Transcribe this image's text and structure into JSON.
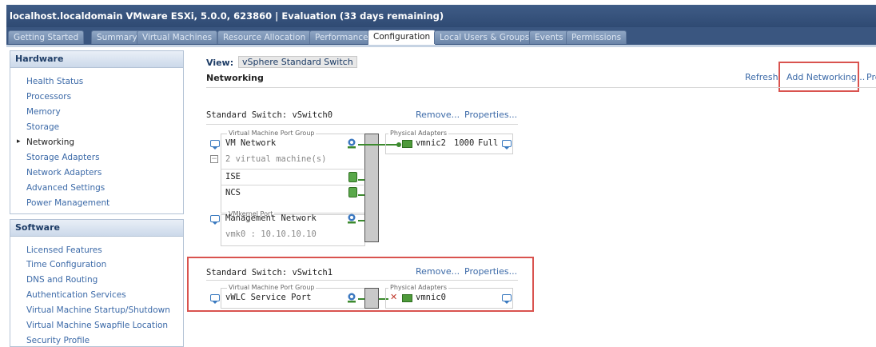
{
  "window": {
    "title": "localhost.localdomain VMware ESXi, 5.0.0, 623860 | Evaluation (33 days remaining)"
  },
  "tabs": [
    {
      "label": "Getting Started"
    },
    {
      "label": "Summary"
    },
    {
      "label": "Virtual Machines"
    },
    {
      "label": "Resource Allocation"
    },
    {
      "label": "Performance"
    },
    {
      "label": "Configuration",
      "active": true
    },
    {
      "label": "Local Users & Groups"
    },
    {
      "label": "Events"
    },
    {
      "label": "Permissions"
    }
  ],
  "sidebar": {
    "hardware_title": "Hardware",
    "hardware_items": [
      {
        "label": "Health Status"
      },
      {
        "label": "Processors"
      },
      {
        "label": "Memory"
      },
      {
        "label": "Storage"
      },
      {
        "label": "Networking",
        "selected": true
      },
      {
        "label": "Storage Adapters"
      },
      {
        "label": "Network Adapters"
      },
      {
        "label": "Advanced Settings"
      },
      {
        "label": "Power Management"
      }
    ],
    "software_title": "Software",
    "software_items": [
      {
        "label": "Licensed Features"
      },
      {
        "label": "Time Configuration"
      },
      {
        "label": "DNS and Routing"
      },
      {
        "label": "Authentication Services"
      },
      {
        "label": "Virtual Machine Startup/Shutdown"
      },
      {
        "label": "Virtual Machine Swapfile Location"
      },
      {
        "label": "Security Profile"
      }
    ]
  },
  "main": {
    "view_label": "View:",
    "view_value": "vSphere Standard Switch",
    "heading": "Networking",
    "actions": {
      "refresh": "Refresh",
      "add_networking": "Add Networking...",
      "properties_partial": "Pro"
    },
    "switch0": {
      "title": "Standard Switch: vSwitch0",
      "remove": "Remove...",
      "properties": "Properties...",
      "vm_port_group_label": "Virtual Machine Port Group",
      "vm_network": "VM Network",
      "vm_count": "2 virtual machine(s)",
      "vms": [
        "ISE",
        "NCS"
      ],
      "vmkernel_label": "VMkernel Port",
      "mgmt_network": "Management Network",
      "vmk": "vmk0 : 10.10.10.10",
      "physical_adapters_label": "Physical Adapters",
      "adapter": "vmnic2",
      "speed": "1000",
      "duplex": "Full"
    },
    "switch1": {
      "title": "Standard Switch: vSwitch1",
      "remove": "Remove...",
      "properties": "Properties...",
      "vm_port_group_label": "Virtual Machine Port Group",
      "port_group": "vWLC Service Port",
      "physical_adapters_label": "Physical Adapters",
      "adapter": "vmnic0"
    }
  },
  "colors": {
    "title_bar": "#2f4a73",
    "link": "#3c6aa8",
    "highlight_box": "#d9534f",
    "nic_green": "#4e9a3a"
  }
}
